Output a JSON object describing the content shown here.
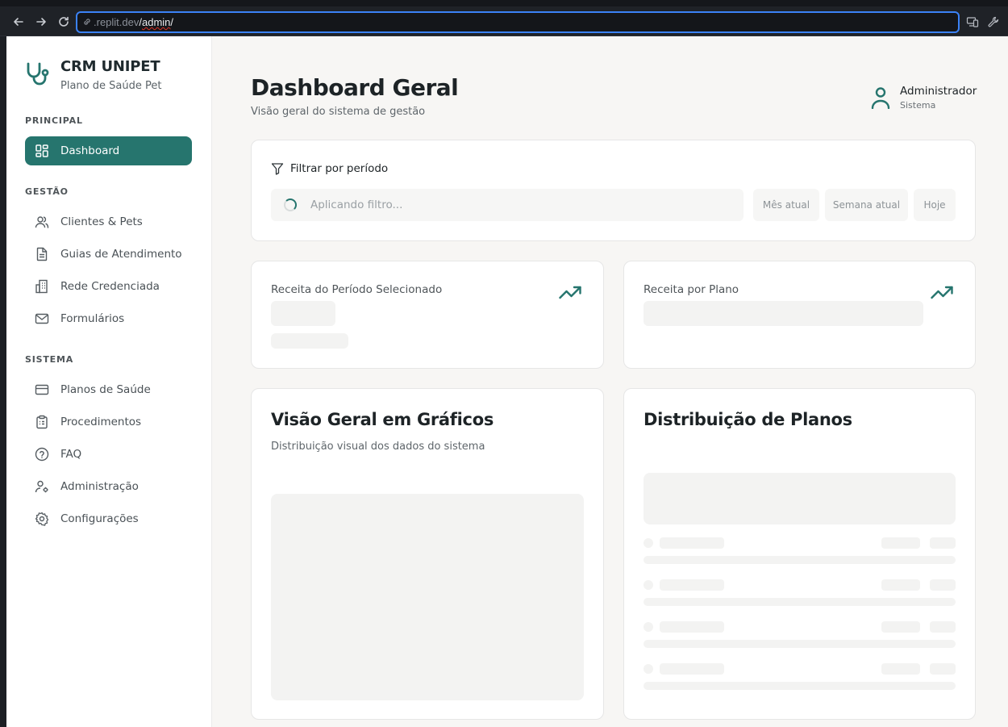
{
  "browser": {
    "url_prefix": ".replit.dev",
    "url_path": "admin",
    "url_slash_a": "/",
    "url_slash_b": "/"
  },
  "brand": {
    "title": "CRM UNIPET",
    "subtitle": "Plano de Saúde Pet"
  },
  "sidebar": {
    "sections": [
      {
        "label": "PRINCIPAL"
      },
      {
        "label": "GESTÃO"
      },
      {
        "label": "SISTEMA"
      }
    ],
    "items": [
      {
        "label": "Dashboard",
        "icon": "dashboard-icon",
        "active": true
      },
      {
        "label": "Clientes & Pets",
        "icon": "users-icon"
      },
      {
        "label": "Guias de Atendimento",
        "icon": "document-icon"
      },
      {
        "label": "Rede Credenciada",
        "icon": "building-icon"
      },
      {
        "label": "Formulários",
        "icon": "mail-icon"
      },
      {
        "label": "Planos de Saúde",
        "icon": "credit-card-icon"
      },
      {
        "label": "Procedimentos",
        "icon": "clipboard-icon"
      },
      {
        "label": "FAQ",
        "icon": "help-circle-icon"
      },
      {
        "label": "Administração",
        "icon": "user-cog-icon"
      },
      {
        "label": "Configurações",
        "icon": "gear-icon"
      }
    ]
  },
  "header": {
    "title": "Dashboard Geral",
    "subtitle": "Visão geral do sistema de gestão",
    "user_name": "Administrador",
    "user_role": "Sistema"
  },
  "filter": {
    "title": "Filtrar por período",
    "placeholder": "Aplicando filtro...",
    "chips": [
      "Mês atual",
      "Semana atual",
      "Hoje"
    ]
  },
  "revenue_cards": [
    {
      "label": "Receita do Período Selecionado"
    },
    {
      "label": "Receita por Plano"
    }
  ],
  "charts_card": {
    "title": "Visão Geral em Gráficos",
    "subtitle": "Distribuição visual dos dados do sistema"
  },
  "plans_card": {
    "title": "Distribuição de Planos"
  },
  "colors": {
    "accent": "#26756e",
    "background": "#f7f6f4",
    "skeleton": "#f3f3f2"
  }
}
